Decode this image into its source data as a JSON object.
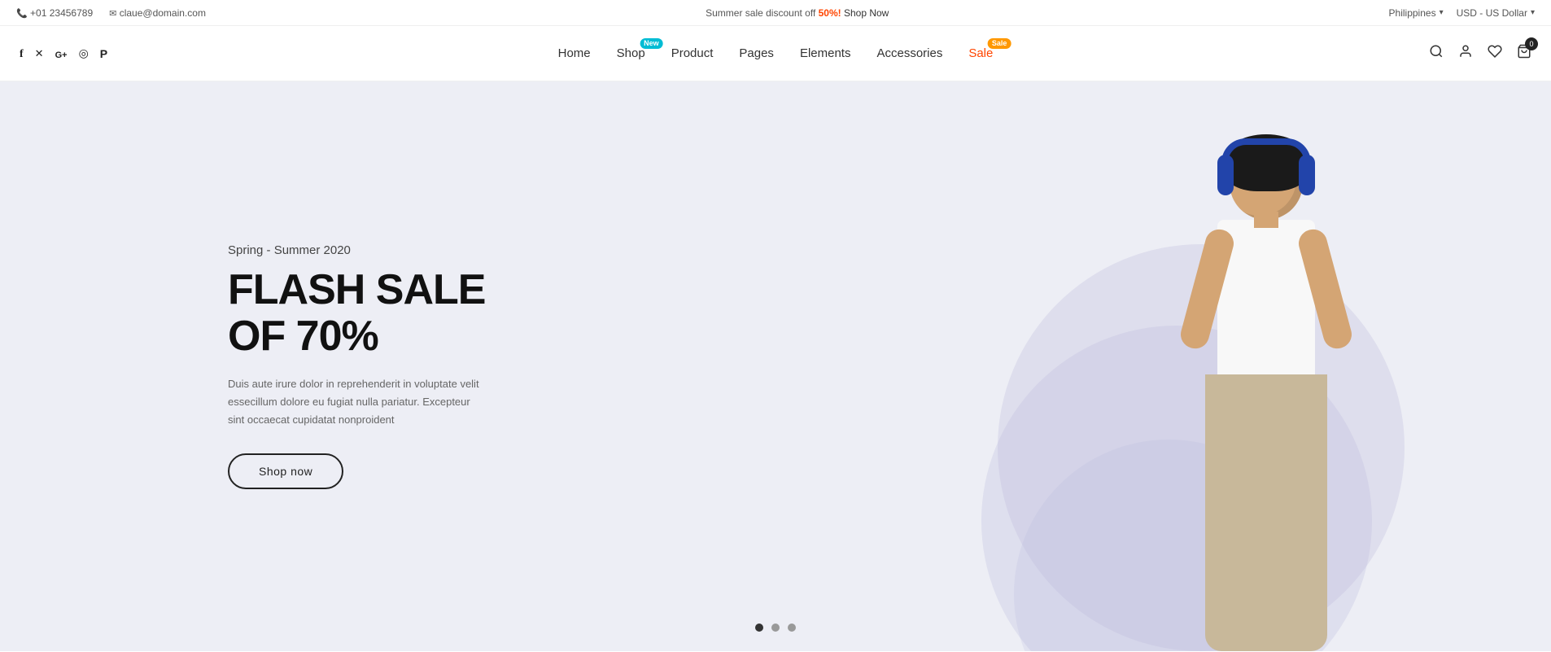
{
  "topbar": {
    "phone": "+01 23456789",
    "email": "claue@domain.com",
    "promo_text": "Summer sale discount off ",
    "promo_percent": "50%!",
    "promo_link": "Shop Now",
    "region": "Philippines",
    "currency": "USD - US Dollar"
  },
  "navbar": {
    "menu_items": [
      {
        "label": "Home",
        "badge": null,
        "color": "normal"
      },
      {
        "label": "Shop",
        "badge": "New",
        "badge_type": "new",
        "color": "normal"
      },
      {
        "label": "Product",
        "badge": null,
        "color": "normal"
      },
      {
        "label": "Pages",
        "badge": null,
        "color": "normal"
      },
      {
        "label": "Elements",
        "badge": null,
        "color": "normal"
      },
      {
        "label": "Accessories",
        "badge": null,
        "color": "normal"
      },
      {
        "label": "Sale",
        "badge": "Sale",
        "badge_type": "sale",
        "color": "orange"
      }
    ],
    "cart_count": "0"
  },
  "hero": {
    "subtitle": "Spring - Summer 2020",
    "title": "FLASH SALE OF 70%",
    "description": "Duis aute irure dolor in reprehenderit in voluptate velit essecillum dolore eu fugiat nulla pariatur. Excepteur sint occaecat cupidatat nonproident",
    "cta_label": "Shop now",
    "slide_dots": [
      {
        "active": true
      },
      {
        "active": false
      },
      {
        "active": false
      }
    ]
  },
  "social_icons": [
    {
      "name": "facebook",
      "symbol": "f"
    },
    {
      "name": "twitter",
      "symbol": "𝕏"
    },
    {
      "name": "google-plus",
      "symbol": "G+"
    },
    {
      "name": "instagram",
      "symbol": "◎"
    },
    {
      "name": "pinterest",
      "symbol": "𝐏"
    }
  ],
  "colors": {
    "topbar_bg": "#ffffff",
    "nav_bg": "#ffffff",
    "hero_bg": "#edeef5",
    "sale_color": "#ff4500",
    "badge_new_bg": "#00bcd4",
    "badge_sale_bg": "#ff9800",
    "accent": "#222222"
  }
}
